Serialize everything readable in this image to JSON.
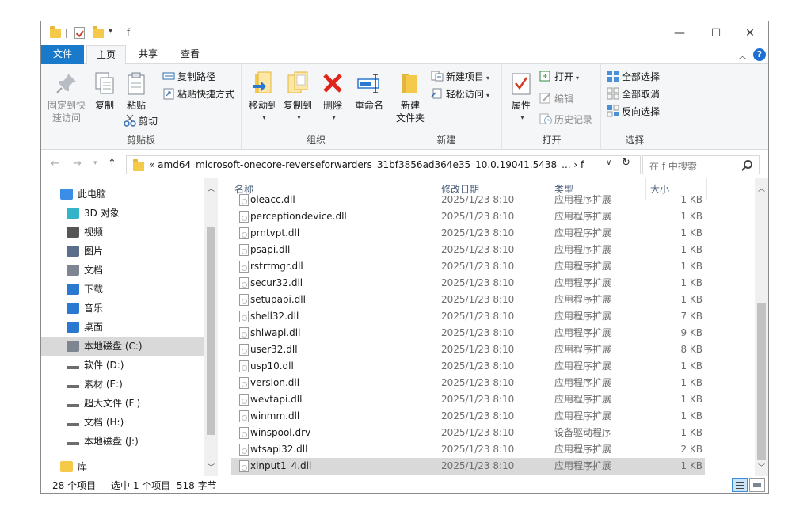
{
  "window": {
    "title": "f",
    "controls": {
      "minimize": "—",
      "maximize": "☐",
      "close": "✕"
    }
  },
  "ribbon_tabs": [
    "文件",
    "主页",
    "共享",
    "查看"
  ],
  "help_label": "?",
  "ribbon": {
    "clipboard": {
      "label": "剪贴板",
      "pin": "固定到快\n速访问",
      "copy": "复制",
      "paste": "粘贴",
      "copy_path": "复制路径",
      "paste_shortcut": "粘贴快捷方式",
      "cut": "剪切"
    },
    "organize": {
      "label": "组织",
      "move_to": "移动到",
      "copy_to": "复制到",
      "delete": "删除",
      "rename": "重命名"
    },
    "new": {
      "label": "新建",
      "new_folder": "新建\n文件夹",
      "new_item": "新建项目",
      "easy_access": "轻松访问"
    },
    "open": {
      "label": "打开",
      "properties": "属性",
      "open": "打开",
      "edit": "编辑",
      "history": "历史记录"
    },
    "select": {
      "label": "选择",
      "select_all": "全部选择",
      "select_none": "全部取消",
      "invert": "反向选择"
    }
  },
  "address": {
    "path": "«  amd64_microsoft-onecore-reverseforwarders_31bf3856ad364e35_10.0.19041.5438_...  ›  f",
    "search_placeholder": "在 f 中搜索"
  },
  "nav": {
    "items": [
      {
        "label": "此电脑",
        "icon": "computer-icon"
      },
      {
        "label": "3D 对象",
        "icon": "3d-objects-icon"
      },
      {
        "label": "视频",
        "icon": "video-icon"
      },
      {
        "label": "图片",
        "icon": "pictures-icon"
      },
      {
        "label": "文档",
        "icon": "documents-icon"
      },
      {
        "label": "下载",
        "icon": "download-icon"
      },
      {
        "label": "音乐",
        "icon": "music-icon"
      },
      {
        "label": "桌面",
        "icon": "desktop-icon"
      },
      {
        "label": "本地磁盘 (C:)",
        "icon": "system-drive-icon"
      },
      {
        "label": "软件 (D:)",
        "icon": "drive-icon"
      },
      {
        "label": "素材 (E:)",
        "icon": "drive-icon"
      },
      {
        "label": "超大文件 (F:)",
        "icon": "drive-icon"
      },
      {
        "label": "文档 (H:)",
        "icon": "drive-icon"
      },
      {
        "label": "本地磁盘 (J:)",
        "icon": "drive-icon"
      },
      {
        "label": "库",
        "icon": "library-icon"
      }
    ]
  },
  "columns": {
    "name": "名称",
    "date": "修改日期",
    "type": "类型",
    "size": "大小"
  },
  "files": [
    {
      "name": "oleacc.dll",
      "date": "2025/1/23 8:10",
      "type": "应用程序扩展",
      "size": "1 KB"
    },
    {
      "name": "perceptiondevice.dll",
      "date": "2025/1/23 8:10",
      "type": "应用程序扩展",
      "size": "1 KB"
    },
    {
      "name": "prntvpt.dll",
      "date": "2025/1/23 8:10",
      "type": "应用程序扩展",
      "size": "1 KB"
    },
    {
      "name": "psapi.dll",
      "date": "2025/1/23 8:10",
      "type": "应用程序扩展",
      "size": "1 KB"
    },
    {
      "name": "rstrtmgr.dll",
      "date": "2025/1/23 8:10",
      "type": "应用程序扩展",
      "size": "1 KB"
    },
    {
      "name": "secur32.dll",
      "date": "2025/1/23 8:10",
      "type": "应用程序扩展",
      "size": "1 KB"
    },
    {
      "name": "setupapi.dll",
      "date": "2025/1/23 8:10",
      "type": "应用程序扩展",
      "size": "1 KB"
    },
    {
      "name": "shell32.dll",
      "date": "2025/1/23 8:10",
      "type": "应用程序扩展",
      "size": "7 KB"
    },
    {
      "name": "shlwapi.dll",
      "date": "2025/1/23 8:10",
      "type": "应用程序扩展",
      "size": "9 KB"
    },
    {
      "name": "user32.dll",
      "date": "2025/1/23 8:10",
      "type": "应用程序扩展",
      "size": "8 KB"
    },
    {
      "name": "usp10.dll",
      "date": "2025/1/23 8:10",
      "type": "应用程序扩展",
      "size": "1 KB"
    },
    {
      "name": "version.dll",
      "date": "2025/1/23 8:10",
      "type": "应用程序扩展",
      "size": "1 KB"
    },
    {
      "name": "wevtapi.dll",
      "date": "2025/1/23 8:10",
      "type": "应用程序扩展",
      "size": "1 KB"
    },
    {
      "name": "winmm.dll",
      "date": "2025/1/23 8:10",
      "type": "应用程序扩展",
      "size": "1 KB"
    },
    {
      "name": "winspool.drv",
      "date": "2025/1/23 8:10",
      "type": "设备驱动程序",
      "size": "1 KB"
    },
    {
      "name": "wtsapi32.dll",
      "date": "2025/1/23 8:10",
      "type": "应用程序扩展",
      "size": "2 KB"
    },
    {
      "name": "xinput1_4.dll",
      "date": "2025/1/23 8:10",
      "type": "应用程序扩展",
      "size": "1 KB"
    }
  ],
  "status": {
    "count": "28 个项目",
    "selection": "选中 1 个项目  518 字节"
  },
  "colors": {
    "accent": "#1979ca",
    "selection": "#d9d9d9",
    "folder": "#f5c94a"
  }
}
